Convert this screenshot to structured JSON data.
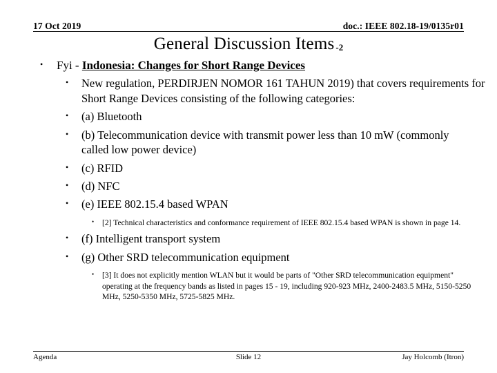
{
  "document": {
    "header": {
      "date": "17 Oct 2019",
      "doc_label": "doc.: IEEE 802.18-19/0135r01"
    },
    "title": {
      "main": "General Discussion Items",
      "suffix": "-2"
    },
    "body": {
      "level1": {
        "bullet": "•",
        "prefix": "Fyi - ",
        "heading": "Indonesia:  Changes for Short Range Devices"
      },
      "items": [
        {
          "bullet": "•",
          "text": "New regulation, PERDIRJEN NOMOR 161 TAHUN 2019) that covers requirements for Short Range Devices consisting of the following categories:"
        },
        {
          "bullet": "•",
          "text": "(a)  Bluetooth"
        },
        {
          "bullet": "•",
          "text": "(b)  Telecommunication device with transmit power less than 10 mW (commonly called low power device)"
        },
        {
          "bullet": "•",
          "text": "(c)  RFID"
        },
        {
          "bullet": "•",
          "text": "(d)  NFC"
        },
        {
          "bullet": "•",
          "text": "(e)  IEEE 802.15.4 based WPAN"
        }
      ],
      "note1": {
        "bullet": "•",
        "text": "[2]  Technical characteristics and conformance requirement of IEEE 802.15.4 based WPAN is shown in page 14."
      },
      "items2": [
        {
          "bullet": "•",
          "text": "(f)  Intelligent transport system"
        },
        {
          "bullet": "•",
          "text": "(g)  Other SRD telecommunication equipment"
        }
      ],
      "note2": {
        "bullet": "•",
        "text": "[3]  It does not explicitly mention WLAN but it would be parts of \"Other SRD telecommunication equipment\" operating at the frequency bands as listed in pages 15 - 19, including 920-923 MHz, 2400-2483.5 MHz, 5150-5250 MHz, 5250-5350 MHz, 5725-5825 MHz."
      }
    },
    "footer": {
      "left": "Agenda",
      "center": "Slide 12",
      "right": "Jay Holcomb (Itron)"
    },
    "colors": {
      "text": "#000000",
      "background": "#ffffff",
      "rule": "#000000"
    }
  }
}
